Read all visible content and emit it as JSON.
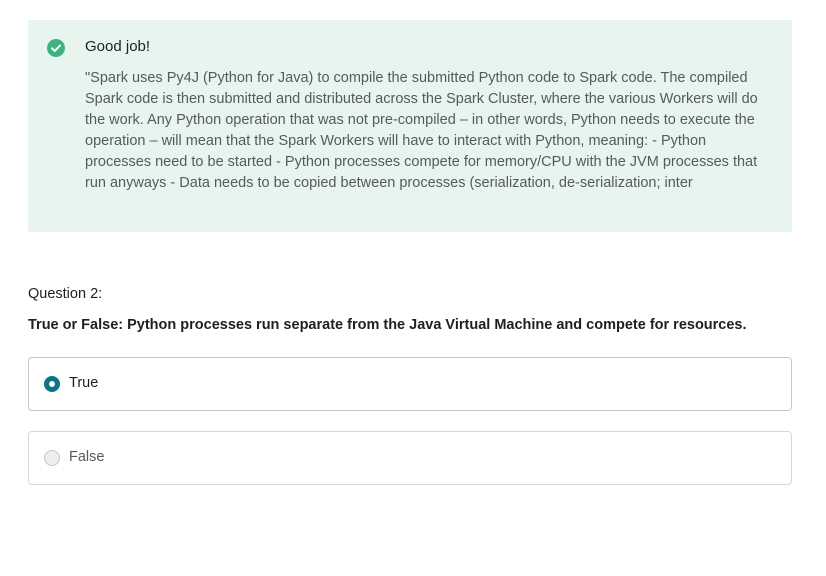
{
  "feedback": {
    "icon": "check-circle-icon",
    "status_color": "#3fb27f",
    "title": "Good job!",
    "explanation": "\"Spark uses Py4J (Python for Java) to compile the submitted Python code to Spark code. The compiled Spark code is then submitted and distributed across the Spark Cluster, where the various Workers will do the work. Any Python operation that was not pre-compiled – in other words, Python needs to execute the operation – will mean that the Spark Workers will have to interact with Python, meaning: - Python processes need to be started - Python processes compete for memory/CPU with the JVM processes that run anyways - Data needs to be copied between processes (serialization, de-serialization; inter"
  },
  "question": {
    "label": "Question 2:",
    "text": "True or False: Python processes run separate from the Java Virtual Machine and compete for resources.",
    "options": [
      {
        "label": "True",
        "selected": true
      },
      {
        "label": "False",
        "selected": false
      }
    ],
    "accent_color": "#0e7385"
  }
}
